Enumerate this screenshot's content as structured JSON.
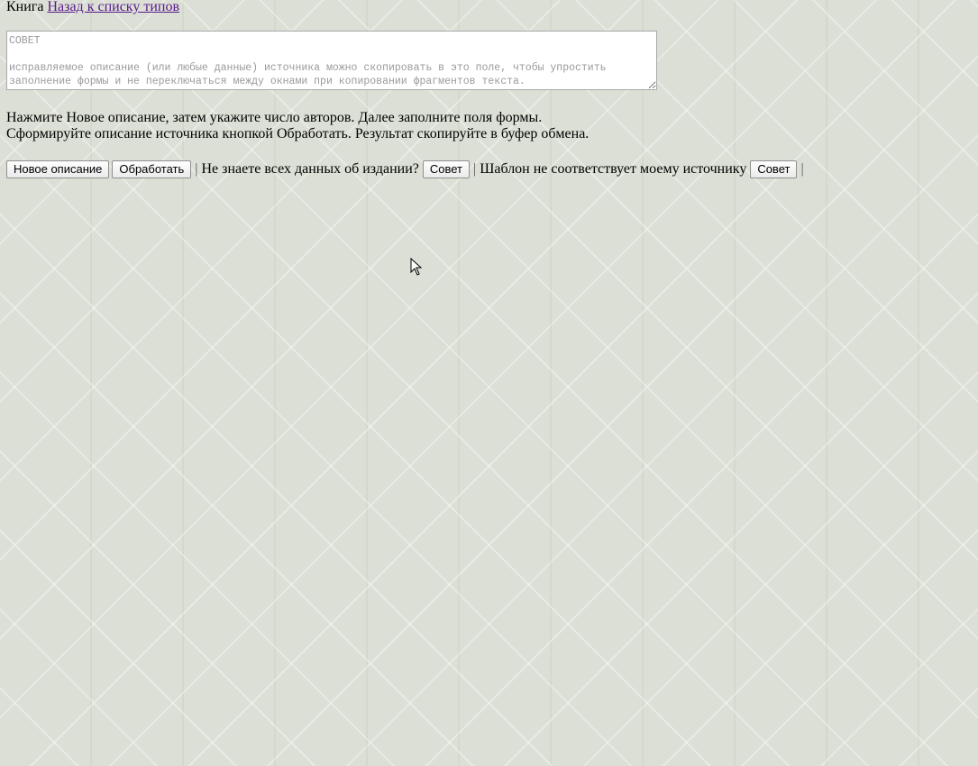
{
  "header": {
    "type_label": "Книга",
    "back_link": "Назад к списку типов"
  },
  "source_field": {
    "placeholder": "СОВЕТ\n\nисправляемое описание (или любые данные) источника можно скопировать в это поле, чтобы упростить заполнение формы и не переключаться между окнами при копировании фрагментов текста.",
    "value": ""
  },
  "instructions": {
    "line1": "Нажмите Новое описание, затем укажите число авторов. Далее заполните поля формы.",
    "line2": "Сформируйте описание источника кнопкой Обработать. Результат скопируйте в буфер обмена."
  },
  "toolbar": {
    "new_description_label": "Новое описание",
    "process_label": "Обработать",
    "separator": "|",
    "unknown_data_text": "Не знаете всех данных об издании?",
    "advice_label_1": "Совет",
    "template_mismatch_text": "Шаблон не соответствует моему источнику",
    "advice_label_2": "Совет"
  },
  "icons": {
    "cursor": "mouse-pointer-icon"
  }
}
